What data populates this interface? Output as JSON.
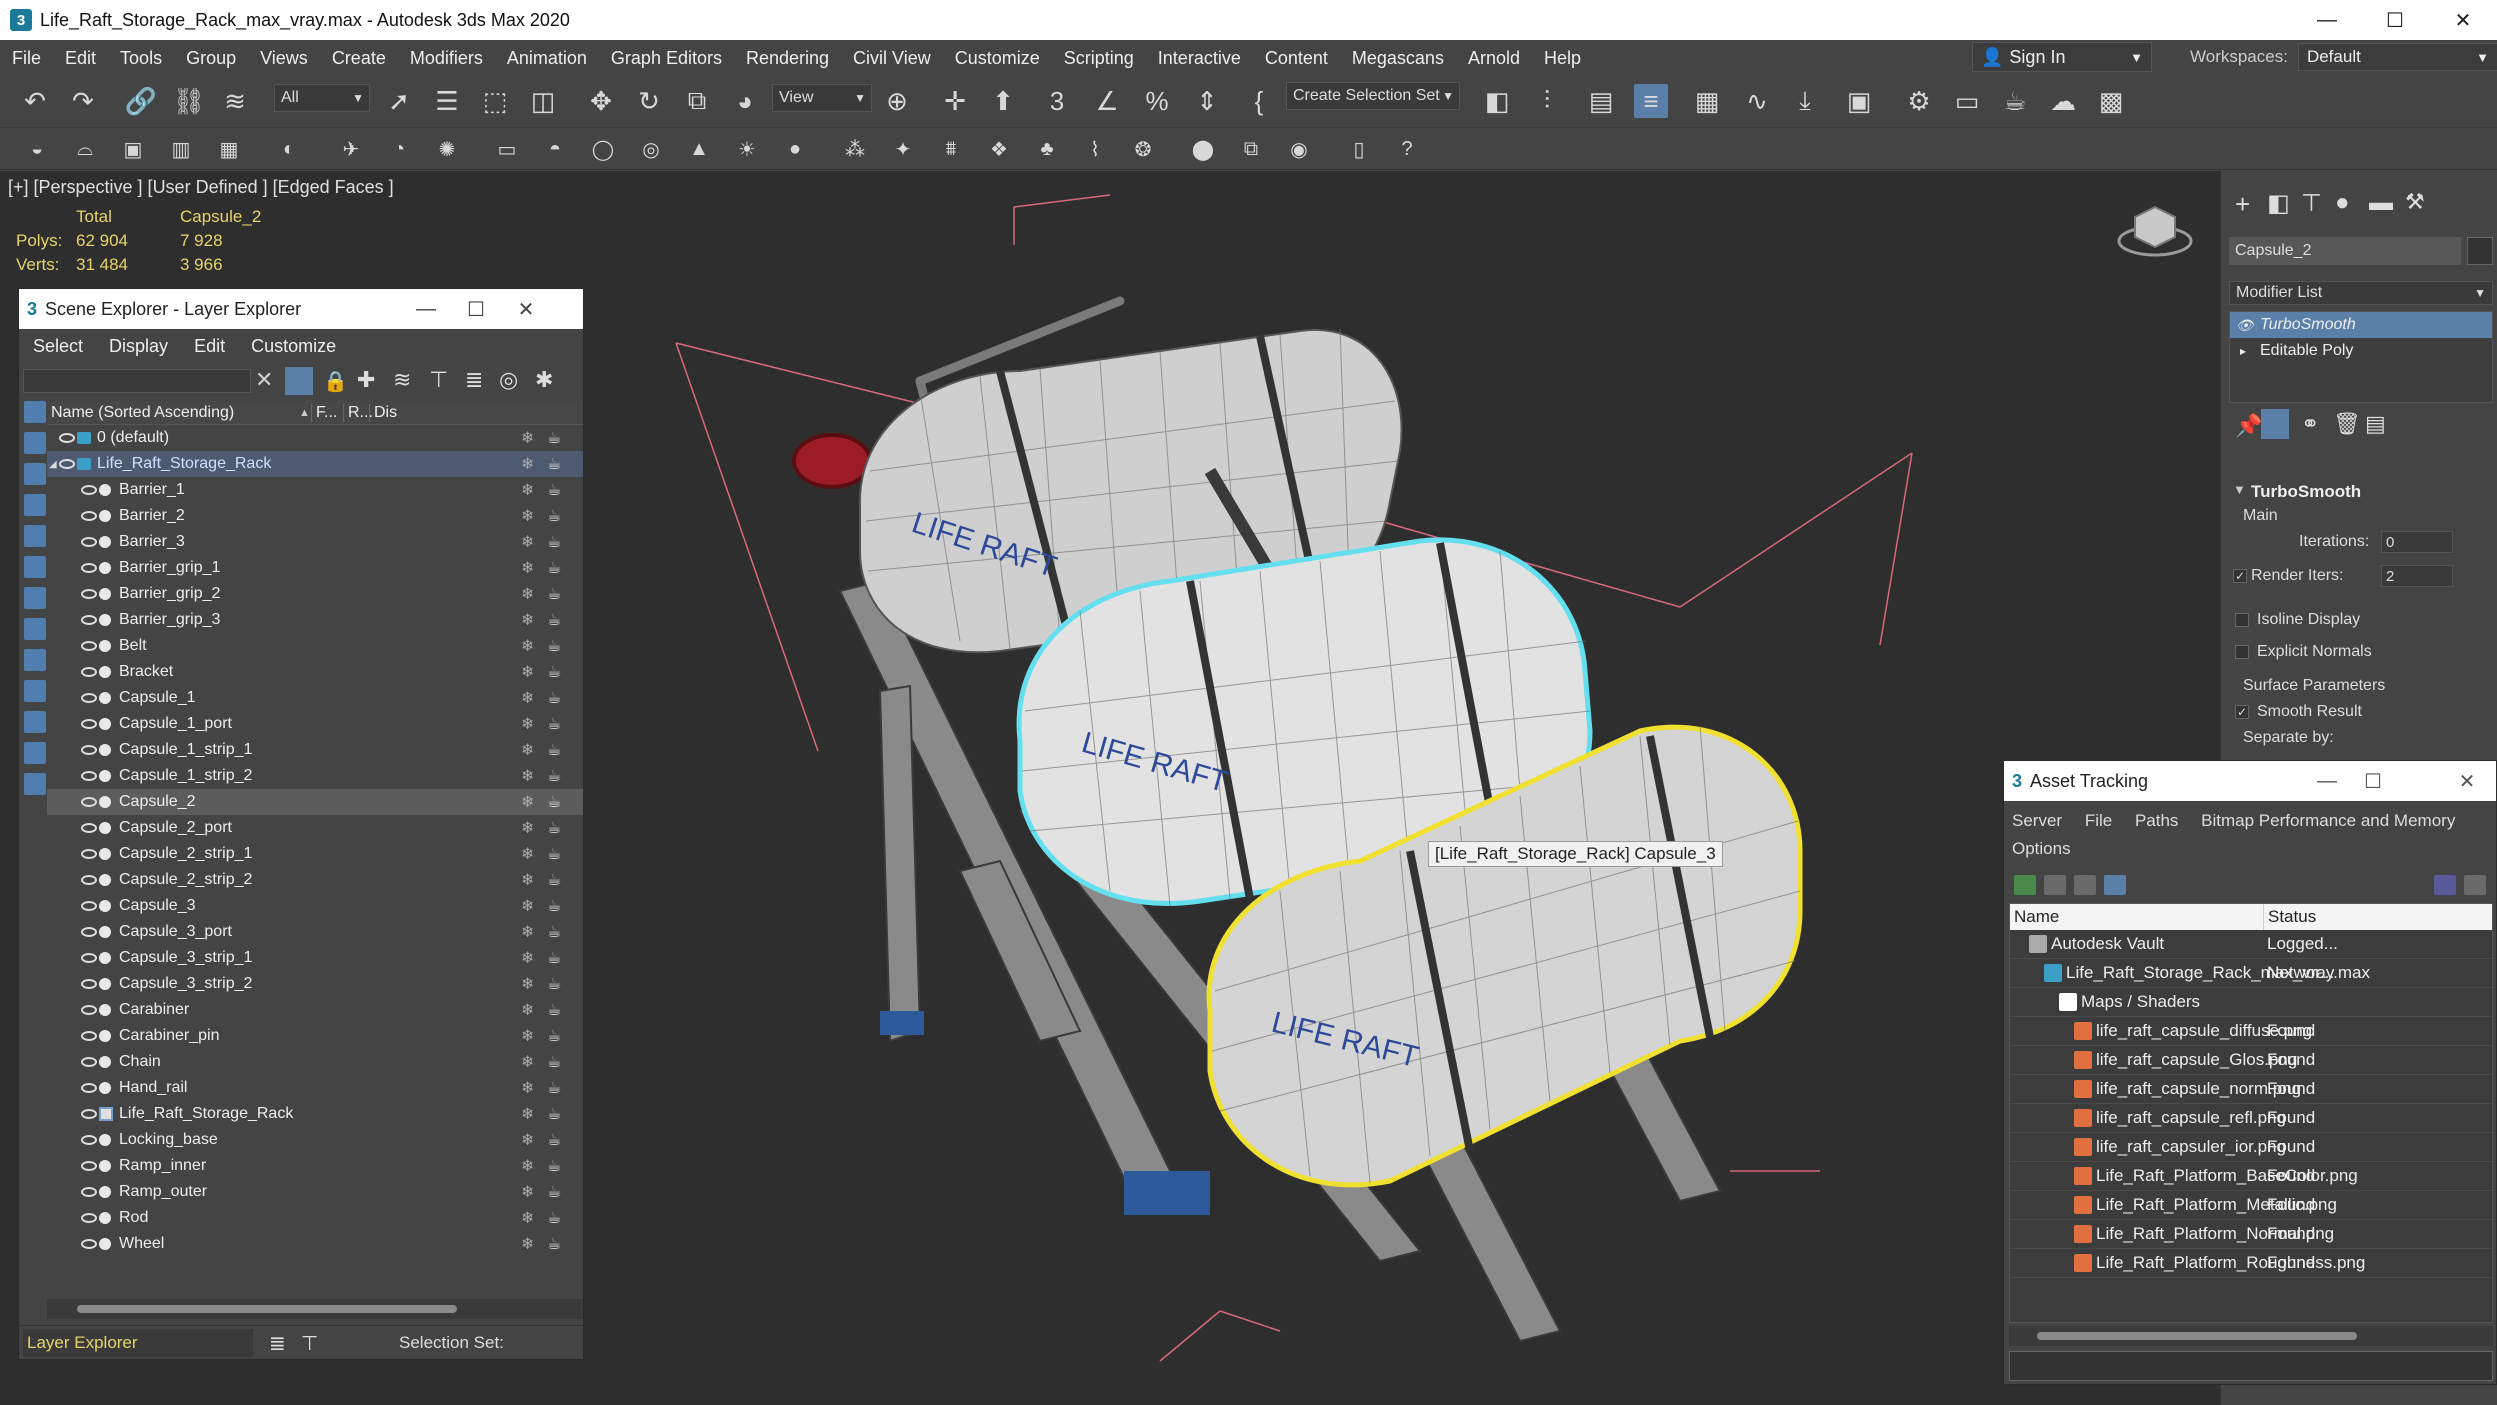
{
  "window": {
    "title": "Life_Raft_Storage_Rack_max_vray.max - Autodesk 3ds Max 2020",
    "app_icon": "3",
    "minimize": "—",
    "maximize": "☐",
    "close": "✕"
  },
  "menu": [
    "File",
    "Edit",
    "Tools",
    "Group",
    "Views",
    "Create",
    "Modifiers",
    "Animation",
    "Graph Editors",
    "Rendering",
    "Civil View",
    "Customize",
    "Scripting",
    "Interactive",
    "Content",
    "Megascans",
    "Arnold",
    "Help"
  ],
  "signin": {
    "label": "Sign In",
    "icon": "person-icon"
  },
  "workspaces": {
    "label": "Workspaces:",
    "value": "Default"
  },
  "toolbar": {
    "selection_filter": "All",
    "reference_coord": "View",
    "named_selection": "Create Selection Set"
  },
  "viewport": {
    "label": "[+] [Perspective ] [User Defined ] [Edged Faces ]",
    "stats": {
      "header_total": "Total",
      "header_object": "Capsule_2",
      "polys_label": "Polys:",
      "polys_total": "62 904",
      "polys_object": "7 928",
      "verts_label": "Verts:",
      "verts_total": "31 484",
      "verts_object": "3 966"
    },
    "tooltip": "[Life_Raft_Storage_Rack] Capsule_3",
    "colors": {
      "selected_outline": "#63dff0",
      "hover_outline": "#f0e030",
      "bounding_box": "#d6697a"
    }
  },
  "scene_explorer": {
    "title": "Scene Explorer - Layer Explorer",
    "menu": [
      "Select",
      "Display",
      "Edit",
      "Customize"
    ],
    "col_name": "Name (Sorted Ascending)",
    "col_frozen": "F...",
    "col_render": "R...",
    "col_display": "Dis",
    "rows": [
      {
        "name": "0 (default)",
        "level": 0,
        "kind": "layer"
      },
      {
        "name": "Life_Raft_Storage_Rack",
        "level": 0,
        "kind": "layer-parent"
      },
      {
        "name": "Barrier_1",
        "level": 1
      },
      {
        "name": "Barrier_2",
        "level": 1
      },
      {
        "name": "Barrier_3",
        "level": 1
      },
      {
        "name": "Barrier_grip_1",
        "level": 1
      },
      {
        "name": "Barrier_grip_2",
        "level": 1
      },
      {
        "name": "Barrier_grip_3",
        "level": 1
      },
      {
        "name": "Belt",
        "level": 1
      },
      {
        "name": "Bracket",
        "level": 1
      },
      {
        "name": "Capsule_1",
        "level": 1
      },
      {
        "name": "Capsule_1_port",
        "level": 1
      },
      {
        "name": "Capsule_1_strip_1",
        "level": 1
      },
      {
        "name": "Capsule_1_strip_2",
        "level": 1
      },
      {
        "name": "Capsule_2",
        "level": 1,
        "selected": true
      },
      {
        "name": "Capsule_2_port",
        "level": 1
      },
      {
        "name": "Capsule_2_strip_1",
        "level": 1
      },
      {
        "name": "Capsule_2_strip_2",
        "level": 1
      },
      {
        "name": "Capsule_3",
        "level": 1
      },
      {
        "name": "Capsule_3_port",
        "level": 1
      },
      {
        "name": "Capsule_3_strip_1",
        "level": 1
      },
      {
        "name": "Capsule_3_strip_2",
        "level": 1
      },
      {
        "name": "Carabiner",
        "level": 1
      },
      {
        "name": "Carabiner_pin",
        "level": 1
      },
      {
        "name": "Chain",
        "level": 1
      },
      {
        "name": "Hand_rail",
        "level": 1
      },
      {
        "name": "Life_Raft_Storage_Rack",
        "level": 1,
        "kind": "group"
      },
      {
        "name": "Locking_base",
        "level": 1
      },
      {
        "name": "Ramp_inner",
        "level": 1
      },
      {
        "name": "Ramp_outer",
        "level": 1
      },
      {
        "name": "Rod",
        "level": 1
      },
      {
        "name": "Wheel",
        "level": 1
      }
    ],
    "footer_explorer": "Layer Explorer",
    "footer_selection": "Selection Set:"
  },
  "command_panel": {
    "object_name": "Capsule_2",
    "modifier_list": "Modifier List",
    "stack": [
      "TurboSmooth",
      "Editable Poly"
    ],
    "rollout_title": "TurboSmooth",
    "main_label": "Main",
    "iterations_label": "Iterations:",
    "iterations_value": "0",
    "render_iters_label": "Render Iters:",
    "render_iters_value": "2",
    "isoline_label": "Isoline Display",
    "explicit_normals_label": "Explicit Normals",
    "surface_params_label": "Surface Parameters",
    "smooth_result_label": "Smooth Result",
    "separate_by_label": "Separate by:"
  },
  "asset_tracking": {
    "title": "Asset Tracking",
    "menu": [
      "Server",
      "File",
      "Paths",
      "Bitmap Performance and Memory",
      "Options"
    ],
    "col_name": "Name",
    "col_status": "Status",
    "rows": [
      {
        "name": "Autodesk Vault",
        "status": "Logged...",
        "indent": 1,
        "icon": "vault"
      },
      {
        "name": "Life_Raft_Storage_Rack_max_vray.max",
        "status": "Networ...",
        "indent": 2,
        "icon": "max"
      },
      {
        "name": "Maps / Shaders",
        "status": "",
        "indent": 3,
        "icon": "maps"
      },
      {
        "name": "life_raft_capsule_diffuse.png",
        "status": "Found",
        "indent": 4,
        "icon": "image"
      },
      {
        "name": "life_raft_capsule_Glos.png",
        "status": "Found",
        "indent": 4,
        "icon": "image"
      },
      {
        "name": "life_raft_capsule_norm.png",
        "status": "Found",
        "indent": 4,
        "icon": "image"
      },
      {
        "name": "life_raft_capsule_refl.png",
        "status": "Found",
        "indent": 4,
        "icon": "image"
      },
      {
        "name": "life_raft_capsuler_ior.png",
        "status": "Found",
        "indent": 4,
        "icon": "image"
      },
      {
        "name": "Life_Raft_Platform_BaseColor.png",
        "status": "Found",
        "indent": 4,
        "icon": "image"
      },
      {
        "name": "Life_Raft_Platform_Metallic.png",
        "status": "Found",
        "indent": 4,
        "icon": "image"
      },
      {
        "name": "Life_Raft_Platform_Normal.png",
        "status": "Found",
        "indent": 4,
        "icon": "image"
      },
      {
        "name": "Life_Raft_Platform_Roughness.png",
        "status": "Found",
        "indent": 4,
        "icon": "image"
      }
    ]
  }
}
